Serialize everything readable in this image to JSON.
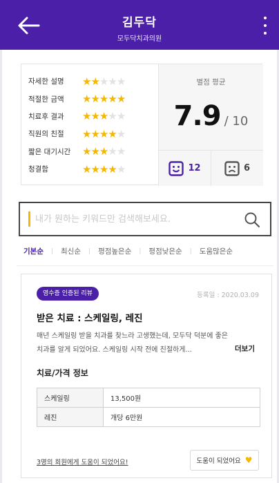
{
  "header": {
    "title": "김두닥",
    "subtitle": "모두닥치과의원"
  },
  "summary": {
    "ratings": [
      {
        "label": "자세한 설명",
        "stars": 2
      },
      {
        "label": "적절한 금액",
        "stars": 5
      },
      {
        "label": "치료후 결과",
        "stars": 3
      },
      {
        "label": "직원의 친절",
        "stars": 4
      },
      {
        "label": "짧은 대기시간",
        "stars": 3
      },
      {
        "label": "청결함",
        "stars": 4
      }
    ],
    "avg_label": "별점 평균",
    "avg_score": "7.9",
    "avg_max": "/ 10",
    "good_count": "12",
    "bad_count": "6"
  },
  "search": {
    "placeholder": "내가 원하는 키워드만 검색해보세요."
  },
  "sort": {
    "options": [
      "기본순",
      "최신순",
      "평점높은순",
      "평점낮은순",
      "도움많은순"
    ],
    "active_index": 0
  },
  "review": {
    "badge": "영수증 인증된 리뷰",
    "date": "등록일 : 2020.03.09",
    "title": "받은 치료 : 스케일링, 레진",
    "body": "매년 스케일링 받을 치과를 찾느라 고생했는데, 모두닥 덕분에 좋은 치과를 알게 되었어요. 스케일링 시작 전에 친절하게...",
    "more": "더보기",
    "info_title": "치료/가격 정보",
    "prices": [
      {
        "name": "스케일링",
        "price": "13,500원"
      },
      {
        "name": "레진",
        "price": "개당 6만원"
      }
    ],
    "helpful_text": "3명의 회원에게 도움이 되었어요!",
    "helpful_button": "도움이 되었어요"
  },
  "colors": {
    "brand": "#4b1fa8",
    "star": "#f5b800"
  },
  "icons": {
    "back": "arrow-left-icon",
    "more": "more-vertical-icon",
    "search": "search-icon",
    "good": "smile-face-icon",
    "bad": "sad-face-icon",
    "heart": "heart-icon"
  }
}
